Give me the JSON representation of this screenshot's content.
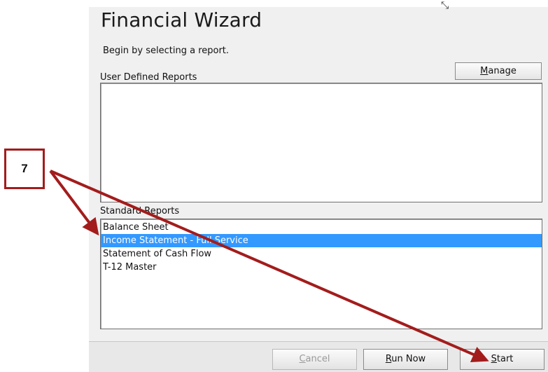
{
  "window": {
    "title": "Financial Wizard",
    "subtitle": "Begin by selecting a report."
  },
  "user_defined": {
    "label": "User Defined Reports",
    "manage_label": "Manage",
    "items": []
  },
  "standard": {
    "label": "Standard Reports",
    "items": [
      {
        "label": "Balance Sheet",
        "selected": false
      },
      {
        "label": "Income Statement - Full Service",
        "selected": true
      },
      {
        "label": "Statement of Cash Flow",
        "selected": false
      },
      {
        "label": "T-12 Master",
        "selected": false
      }
    ]
  },
  "footer": {
    "cancel_label": "Cancel",
    "run_now_label": "Run Now",
    "start_label": "Start"
  },
  "annotation": {
    "step_number": "7",
    "color": "#a31c1c"
  },
  "colors": {
    "selection": "#3399ff",
    "window_bg": "#f0f0f0"
  }
}
